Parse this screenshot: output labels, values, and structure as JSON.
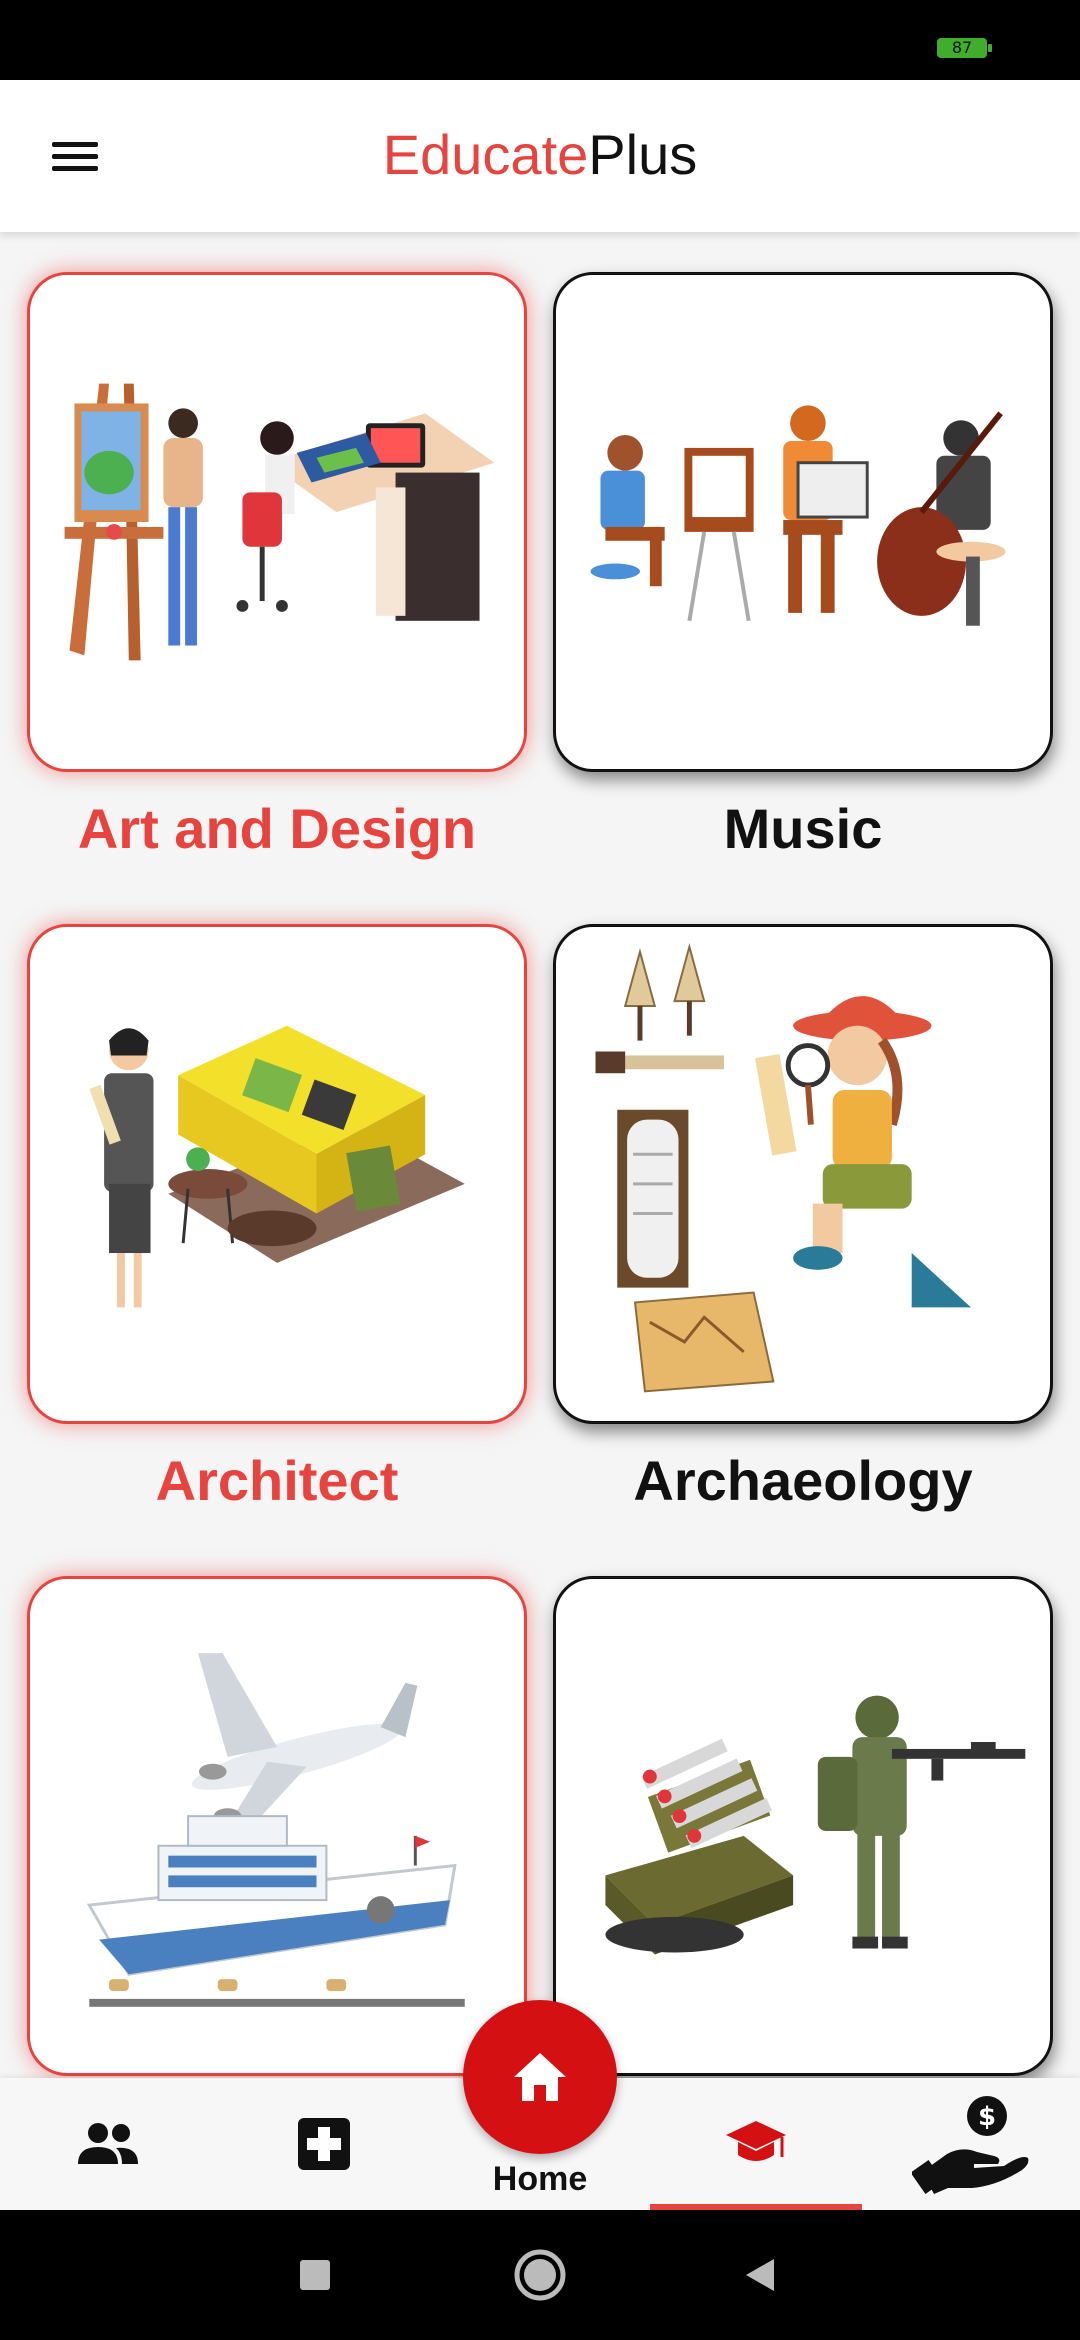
{
  "status_bar": {
    "battery": "87"
  },
  "app_bar": {
    "title_part1": "Educate",
    "title_part2": "Plus"
  },
  "cards": [
    {
      "label": "Art and Design",
      "highlight": "red"
    },
    {
      "label": "Music",
      "highlight": "black"
    },
    {
      "label": "Architect",
      "highlight": "red"
    },
    {
      "label": "Archaeology",
      "highlight": "black"
    },
    {
      "label": "",
      "highlight": "red"
    },
    {
      "label": "",
      "highlight": "black"
    }
  ],
  "bottom_nav": {
    "items": [
      {
        "icon": "people-icon"
      },
      {
        "icon": "medical-plus-icon"
      },
      {
        "icon": "home-icon",
        "label": "Home"
      },
      {
        "icon": "graduation-cap-icon",
        "active": true
      },
      {
        "icon": "money-hand-icon"
      }
    ]
  },
  "colors": {
    "accent": "#e8443f",
    "fab": "#d41012",
    "text": "#111111"
  }
}
